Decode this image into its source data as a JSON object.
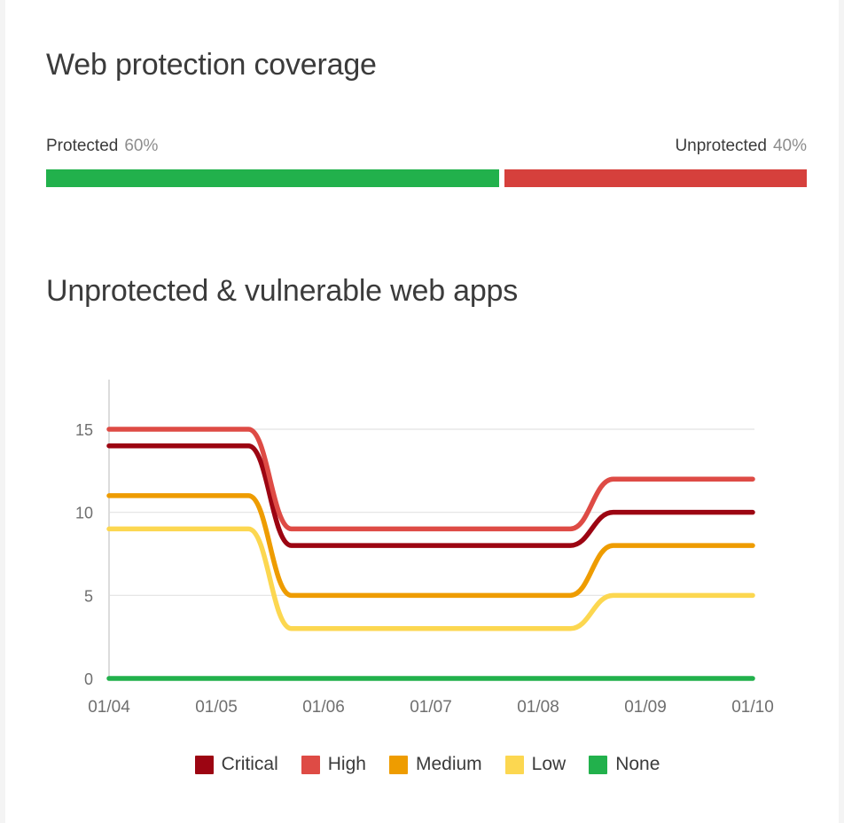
{
  "coverage": {
    "title": "Web protection coverage",
    "protected_label": "Protected",
    "protected_value": "60%",
    "protected_pct": 60,
    "unprotected_label": "Unprotected",
    "unprotected_value": "40%",
    "unprotected_pct": 40,
    "protected_color": "#22b14c",
    "unprotected_color": "#d6403c"
  },
  "chart_data": {
    "type": "line",
    "title": "Unprotected & vulnerable web apps",
    "xlabel": "",
    "ylabel": "",
    "categories": [
      "01/04",
      "01/05",
      "01/06",
      "01/07",
      "01/08",
      "01/09",
      "01/10"
    ],
    "yticks": [
      0,
      5,
      10,
      15
    ],
    "ylim": [
      0,
      16
    ],
    "grid": true,
    "legend_position": "bottom",
    "series": [
      {
        "name": "Critical",
        "color": "#9c0512",
        "values": [
          14,
          14,
          8,
          8,
          8,
          10,
          10
        ]
      },
      {
        "name": "High",
        "color": "#de4b45",
        "values": [
          15,
          15,
          9,
          9,
          9,
          12,
          12
        ]
      },
      {
        "name": "Medium",
        "color": "#ee9c00",
        "values": [
          11,
          11,
          5,
          5,
          5,
          8,
          8
        ]
      },
      {
        "name": "Low",
        "color": "#fcd750",
        "values": [
          9,
          9,
          3,
          3,
          3,
          5,
          5
        ]
      },
      {
        "name": "None",
        "color": "#22b14c",
        "values": [
          0,
          0,
          0,
          0,
          0,
          0,
          0
        ]
      }
    ]
  }
}
